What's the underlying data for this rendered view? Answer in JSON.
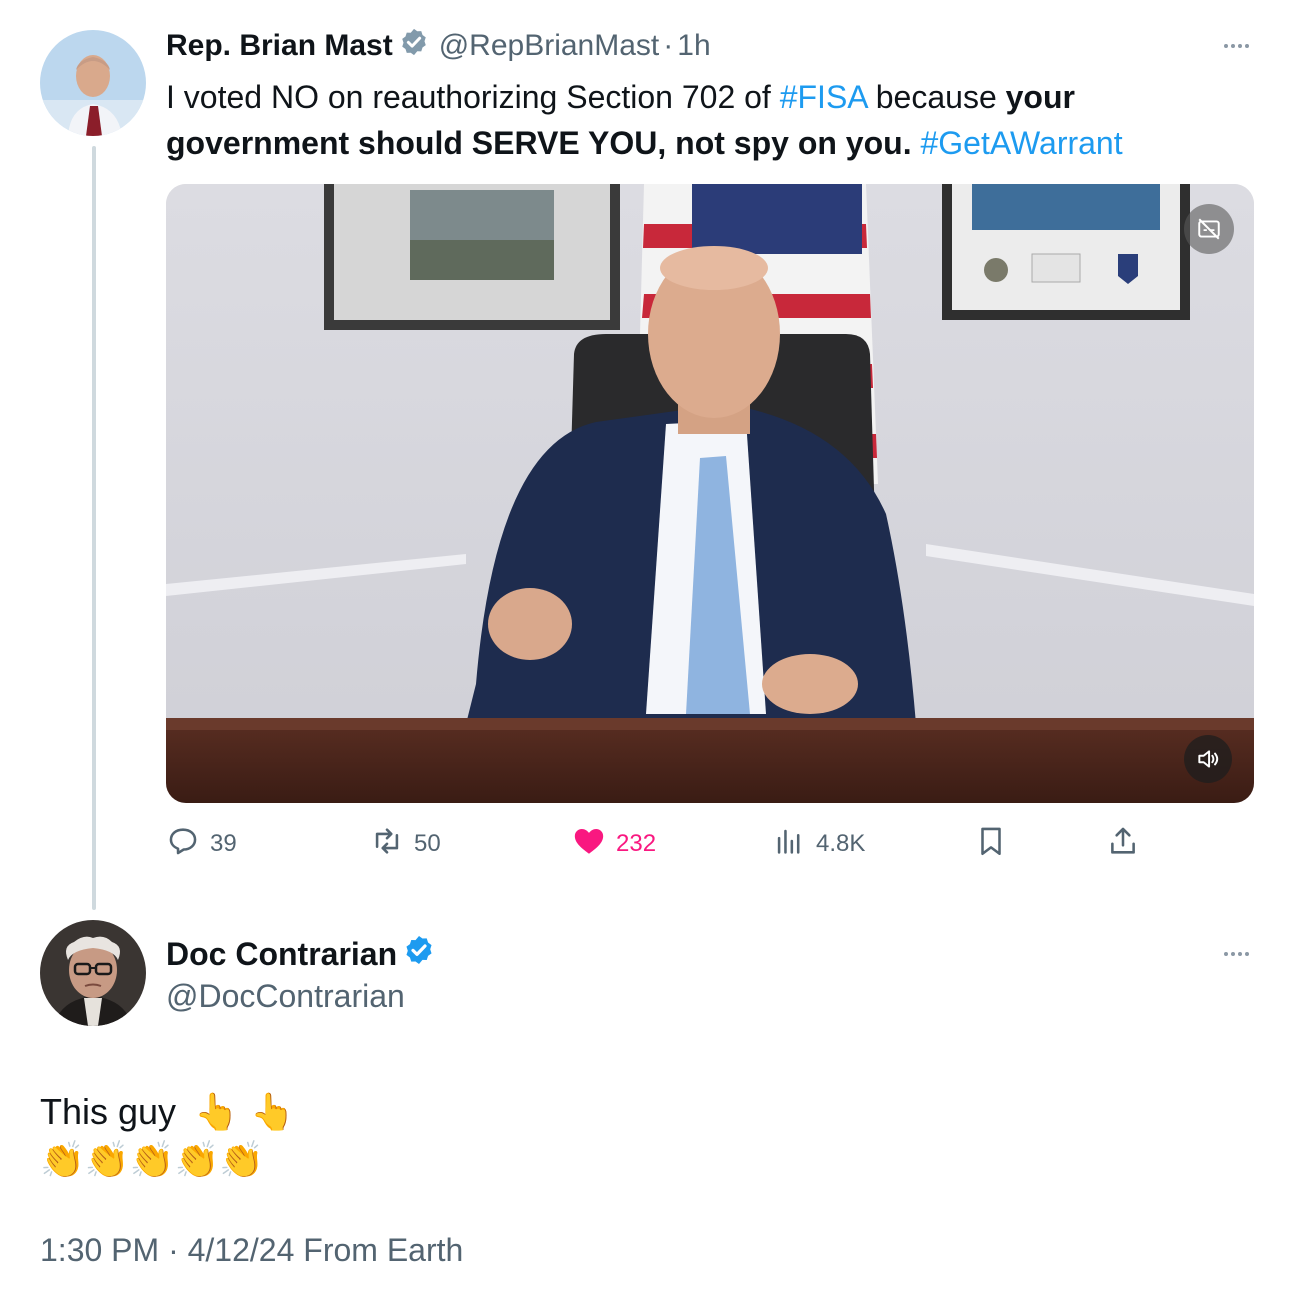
{
  "colors": {
    "text": "#0f1419",
    "secondary": "#536471",
    "link": "#1d9bf0",
    "like": "#f91880",
    "verified_gray": "#829aab",
    "verified_blue": "#1d9bf0"
  },
  "original_tweet": {
    "name": "Rep. Brian Mast",
    "handle": "@RepBrianMast",
    "separator": "·",
    "time": "1h",
    "verified_icon": "gray-government-badge",
    "text_part1": "I voted NO on reauthorizing Section 702 of ",
    "hashtag_fisa": "#FISA",
    "text_part2": " because ",
    "bold_text": "your government should SERVE YOU, not spy on you.",
    "text_part3": " ",
    "hashtag_warrant": "#GetAWarrant",
    "media": {
      "type": "video",
      "captions_icon": "captions-off-icon",
      "sound_icon": "volume-icon"
    },
    "actions": {
      "replies": "39",
      "retweets": "50",
      "likes": "232",
      "views": "4.8K"
    }
  },
  "reply": {
    "name": "Doc Contrarian",
    "handle": "@DocContrarian",
    "verified_icon": "blue-verified-badge",
    "text": "This guy",
    "emoji_line1": "👆 👆",
    "emoji_line2": "👏👏👏👏👏",
    "timestamp": "1:30 PM · 4/12/24 From Earth"
  }
}
